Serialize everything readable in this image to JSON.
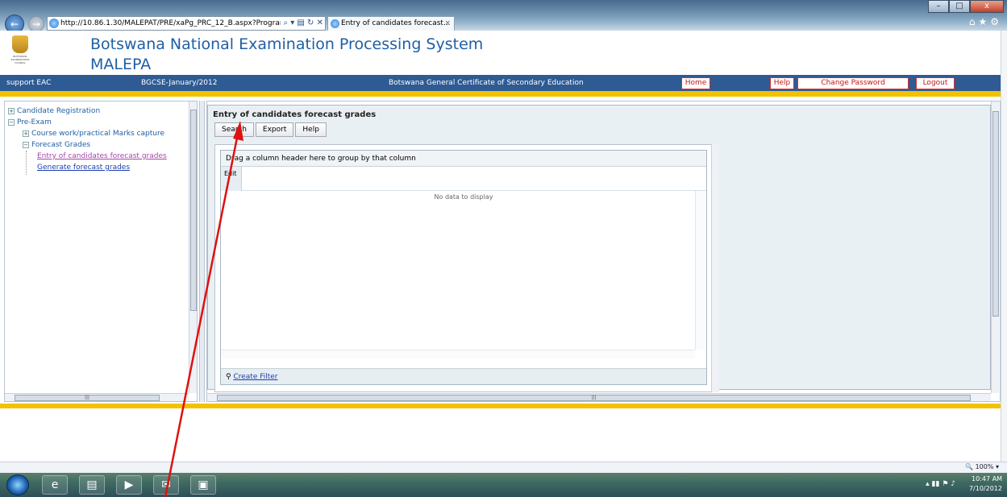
{
  "browser": {
    "url": "http://10.86.1.30/MALEPAT/PRE/xaPg_PRC_12_B.aspx?Progran",
    "tab_title": "Entry of candidates forecast...",
    "tab_close": "×",
    "zoom": "100%",
    "window_buttons": [
      "–",
      "□",
      "x"
    ]
  },
  "header": {
    "title_line1": "Botswana National Examination Processing System",
    "title_line2": "MALEPA",
    "logo_text": "BOTSWANA EXAMINATIONS COUNCIL"
  },
  "navbar": {
    "user": "support EAC",
    "session": "BGCSE-January/2012",
    "program": "Botswana General Certificate of Secondary Education",
    "buttons": [
      "Home",
      "Help",
      "Change Password",
      "Logout"
    ]
  },
  "tree": {
    "items": [
      {
        "label": "Candidate Registration",
        "expander": "+"
      },
      {
        "label": "Pre-Exam",
        "expander": "−"
      },
      {
        "label": "Course work/practical Marks capture",
        "expander": "+"
      },
      {
        "label": "Forecast Grades",
        "expander": "−"
      },
      {
        "label": "Entry of candidates forecast grades"
      },
      {
        "label": "Generate forecast grades"
      }
    ]
  },
  "content": {
    "title": "Entry of candidates forecast grades",
    "toolbar": [
      "Search",
      "Export",
      "Help"
    ],
    "grid": {
      "group_panel_text": "Drag a column header here to group by that column",
      "column_header": "Edit",
      "empty_text": "No data to display",
      "filter_link": "Create Filter"
    }
  },
  "taskbar": {
    "time": "10:47 AM",
    "date": "7/10/2012"
  },
  "colors": {
    "brand_blue": "#2e5b93",
    "accent_yellow": "#f2c200",
    "annotation_red": "#e01010"
  }
}
